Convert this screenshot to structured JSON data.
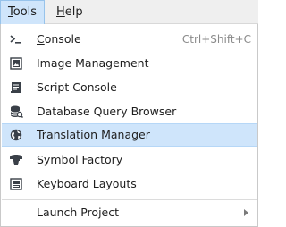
{
  "menubar": {
    "items": [
      {
        "mnemonic": "T",
        "rest": "ools",
        "active": true
      },
      {
        "mnemonic": "H",
        "rest": "elp",
        "active": false
      }
    ]
  },
  "menu": {
    "items": [
      {
        "label_mnemonic": "C",
        "label_rest": "onsole",
        "shortcut": "Ctrl+Shift+C",
        "icon": "console-icon"
      },
      {
        "label": "Image Management",
        "icon": "image-icon"
      },
      {
        "label": "Script Console",
        "icon": "script-icon"
      },
      {
        "label": "Database Query Browser",
        "icon": "database-icon"
      },
      {
        "label": "Translation Manager",
        "icon": "globe-icon",
        "highlighted": true
      },
      {
        "label": "Symbol Factory",
        "icon": "symbol-icon"
      },
      {
        "label": "Keyboard Layouts",
        "icon": "keyboard-icon"
      },
      {
        "label": "Launch Project",
        "icon": "",
        "has_submenu": true
      }
    ]
  },
  "colors": {
    "highlight": "#cfe5fb",
    "icon_dark": "#3a4048"
  }
}
